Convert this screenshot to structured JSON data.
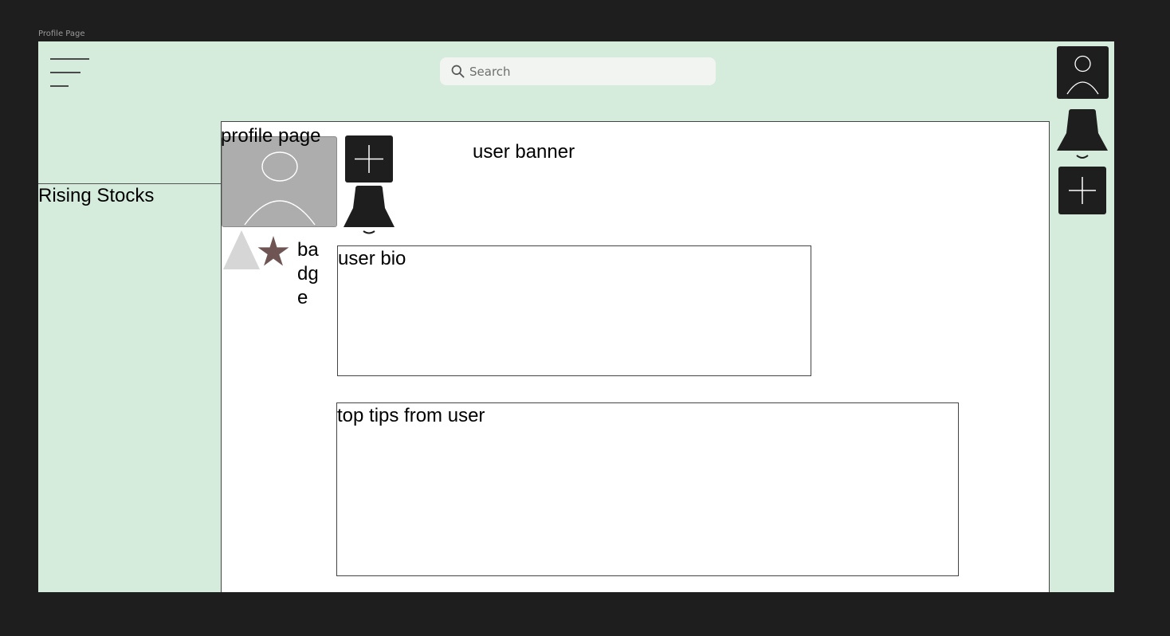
{
  "frame": {
    "label": "Profile Page"
  },
  "header": {
    "menu_icon": "hamburger-menu-icon",
    "search": {
      "placeholder": "Search",
      "value": "",
      "icon": "search-icon"
    }
  },
  "right_rail": {
    "items": [
      {
        "icon": "user-icon"
      },
      {
        "icon": "bell-icon"
      },
      {
        "icon": "plus-icon"
      }
    ]
  },
  "sidebar": {
    "title": "Rising Stocks"
  },
  "profile": {
    "heading": "profile page",
    "avatar_icon": "user-icon",
    "add_icon": "plus-icon",
    "bell_icon": "bell-icon",
    "banner_label": "user banner",
    "badge": {
      "label": "badge",
      "icons": [
        "triangle-icon",
        "star-icon"
      ]
    },
    "bio_label": "user bio",
    "tips_label": "top tips from user"
  },
  "colors": {
    "page_background": "#1e1e1e",
    "frame_background": "#d5ecdc",
    "panel_background": "#ffffff",
    "button_background": "#1e1e1e",
    "avatar_background": "#adadad",
    "star": "#6e5553",
    "triangle": "#d6d6d6"
  }
}
